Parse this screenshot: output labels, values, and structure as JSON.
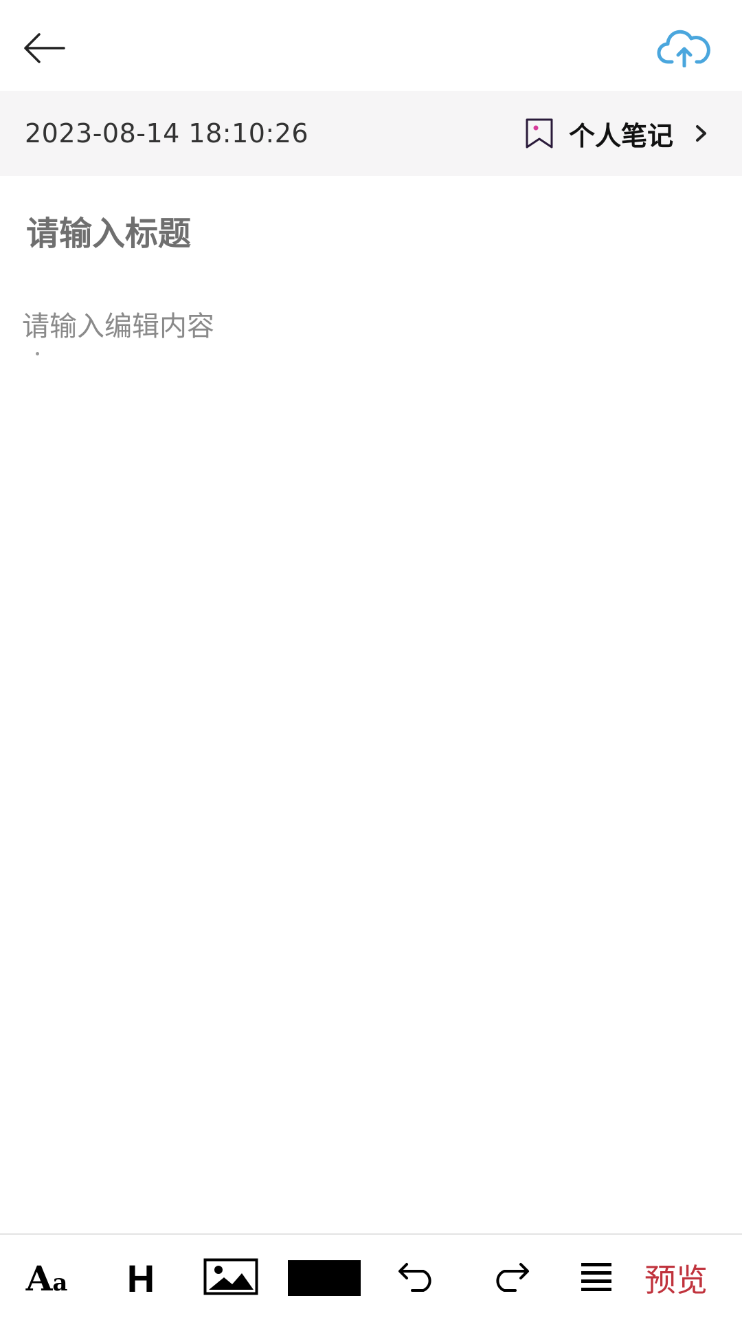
{
  "header": {
    "back_icon": "arrow-left-icon",
    "upload_icon": "cloud-upload-icon",
    "upload_color": "#4aa6dd"
  },
  "meta": {
    "datetime": "2023-08-14 18:10:26",
    "category_icon": "bookmark-icon",
    "category_label": "个人笔记",
    "chevron_icon": "chevron-right-icon"
  },
  "editor": {
    "title_placeholder": "请输入标题",
    "content_placeholder": "请输入编辑内容"
  },
  "toolbar": {
    "font_label_big": "A",
    "font_label_small": "a",
    "heading_label": "H",
    "image_icon": "image-icon",
    "color_value": "#000000",
    "undo_icon": "undo-icon",
    "redo_icon": "redo-icon",
    "align_icon": "align-justify-icon",
    "preview_label": "预览",
    "preview_color": "#c0333d"
  }
}
